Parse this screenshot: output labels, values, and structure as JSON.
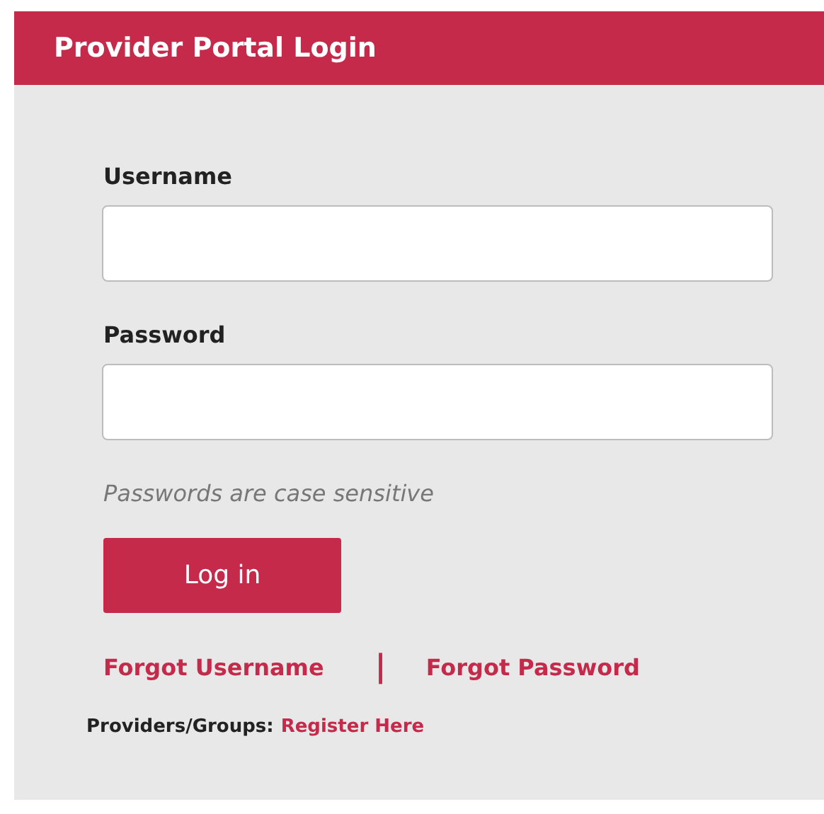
{
  "header": {
    "title": "Provider Portal Login"
  },
  "fields": [
    {
      "label": "Username"
    },
    {
      "label": "Password"
    }
  ],
  "hint": "Passwords are case sensitive",
  "button": "Log in",
  "links": [
    "Forgot Username",
    "Forgot Password"
  ],
  "separator": "|",
  "register": {
    "prefix": "Providers/Groups:",
    "link": "Register Here"
  }
}
